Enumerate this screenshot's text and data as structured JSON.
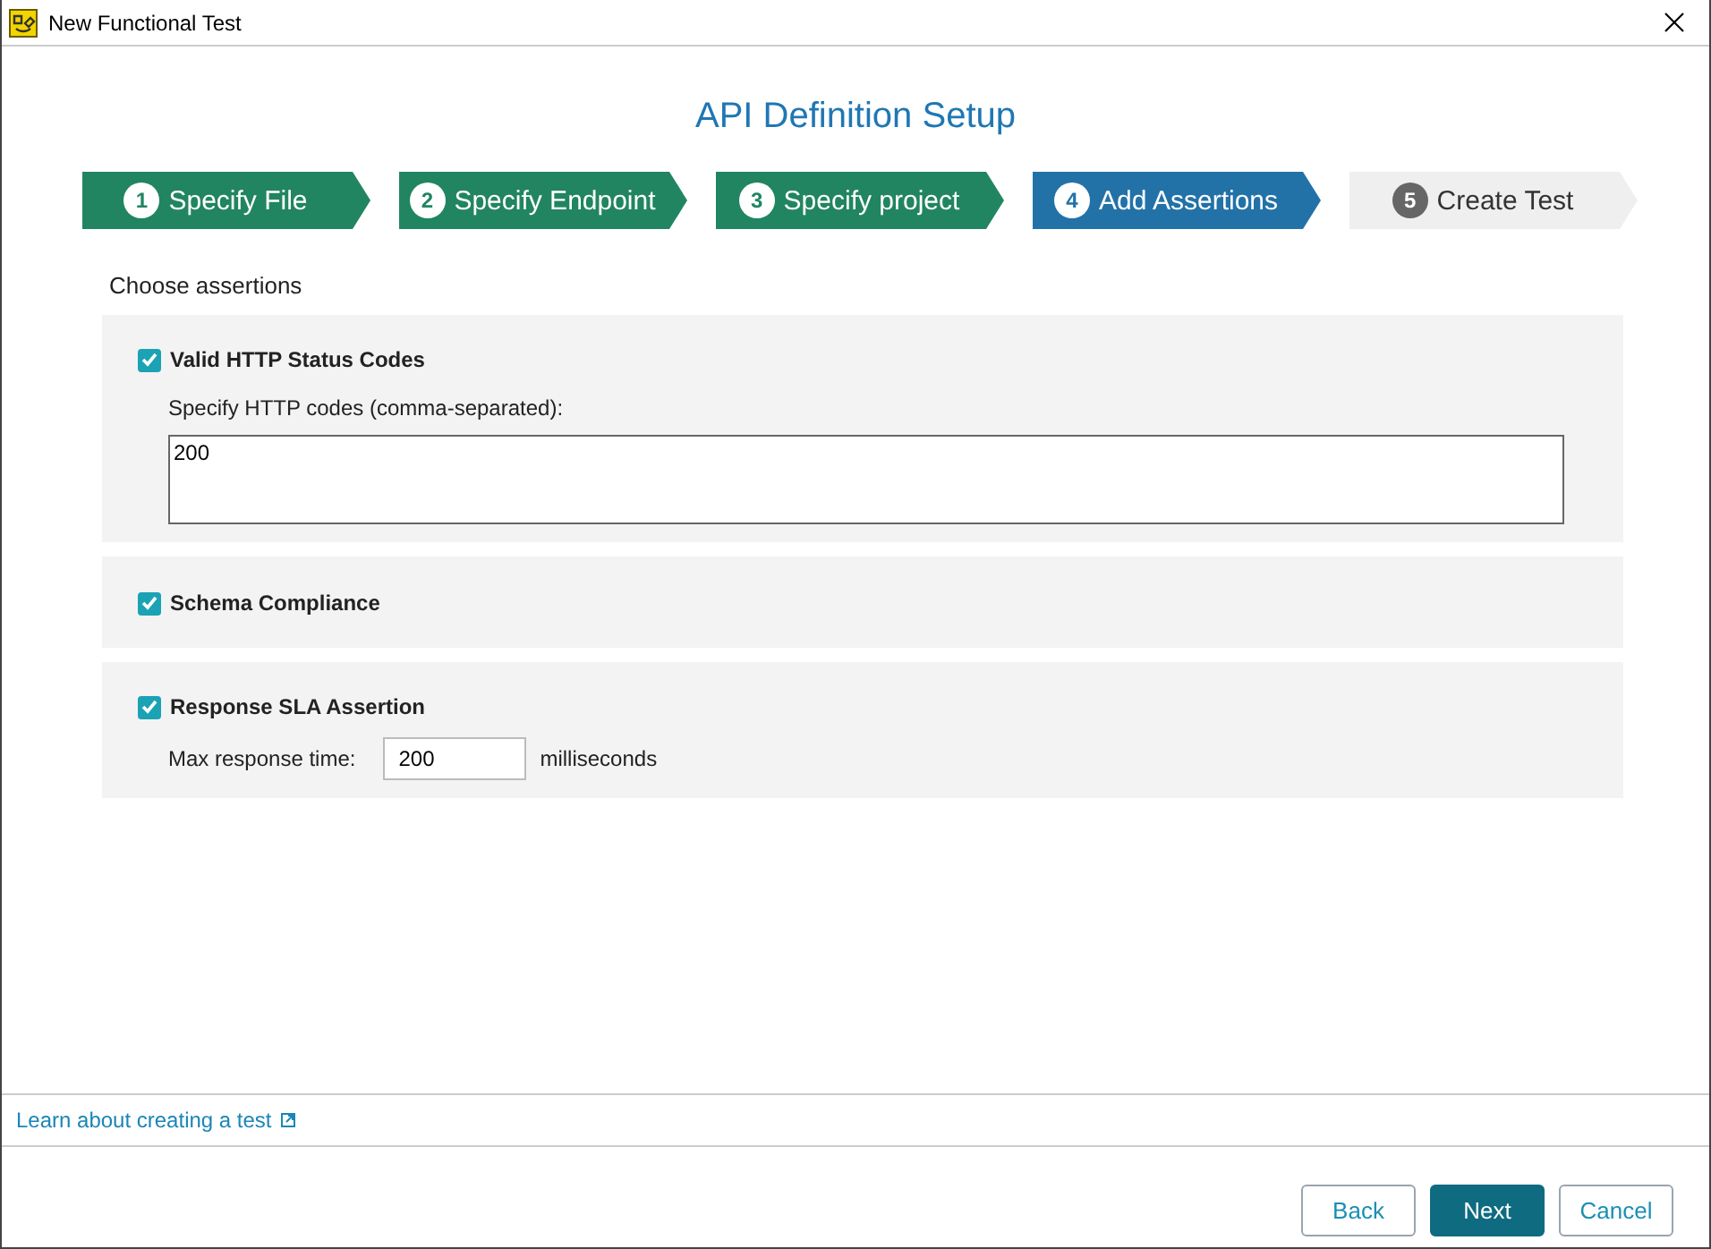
{
  "window": {
    "title": "New Functional Test"
  },
  "heading": "API Definition Setup",
  "steps": [
    {
      "number": "1",
      "label": "Specify File",
      "completed": true,
      "selected": false
    },
    {
      "number": "2",
      "label": "Specify Endpoint",
      "completed": true,
      "selected": false
    },
    {
      "number": "3",
      "label": "Specify project",
      "completed": true,
      "selected": false
    },
    {
      "number": "4",
      "label": "Add Assertions",
      "completed": false,
      "selected": true
    },
    {
      "number": "5",
      "label": "Create Test",
      "completed": false,
      "selected": false
    }
  ],
  "section_label": "Choose assertions",
  "assertions": [
    {
      "kind": "codes",
      "label": "Valid HTTP Status Codes",
      "checked": true,
      "field_label": "Specify HTTP codes (comma-separated):",
      "value": "200"
    },
    {
      "kind": "plain",
      "label": "Schema Compliance",
      "checked": true
    },
    {
      "kind": "sla",
      "label": "Response SLA Assertion",
      "checked": true,
      "field_label": "Max response time:",
      "value": "200",
      "unit": "milliseconds"
    }
  ],
  "help_link": "Learn about creating a test",
  "buttons": [
    {
      "label": "Back",
      "kind": "secondary"
    },
    {
      "label": "Next",
      "kind": "primary"
    },
    {
      "label": "Cancel",
      "kind": "secondary"
    }
  ]
}
